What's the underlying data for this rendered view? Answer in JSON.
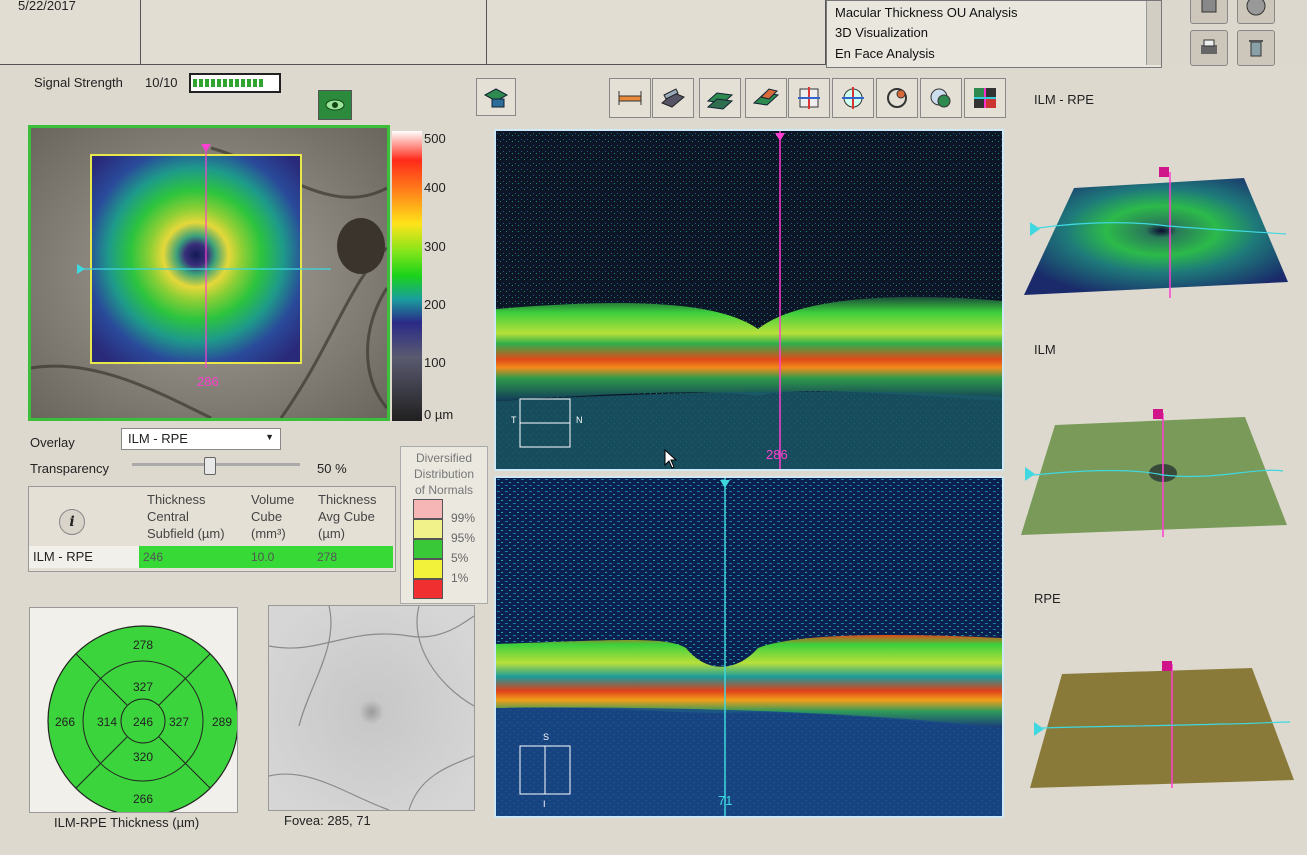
{
  "header": {
    "date": "5/22/2017",
    "menu": [
      "Macular Thickness OU Analysis",
      "3D Visualization",
      "En Face Analysis"
    ]
  },
  "signal": {
    "label": "Signal Strength",
    "value": "10/10",
    "level": 1.0
  },
  "scale": {
    "ticks": [
      "500",
      "400",
      "300",
      "200",
      "100",
      "0 µm"
    ]
  },
  "fundus": {
    "slice_label": "286"
  },
  "overlay": {
    "label": "Overlay",
    "selected": "ILM - RPE",
    "transparency_label": "Transparency",
    "transparency_value": "50 %",
    "transparency_fraction": 0.5
  },
  "table": {
    "headers": [
      [
        "Thickness",
        "Central",
        "Subfield (µm)"
      ],
      [
        "Volume",
        "Cube",
        "(mm³)"
      ],
      [
        "Thickness",
        "Avg Cube",
        "(µm)"
      ]
    ],
    "row_label": "ILM - RPE",
    "values": [
      "246",
      "10.0",
      "278"
    ]
  },
  "normals": {
    "title": [
      "Diversified",
      "Distribution",
      "of Normals"
    ],
    "levels": [
      "99%",
      "95%",
      "5%",
      "1%"
    ],
    "colors": [
      "#f6b6b6",
      "#f2f28a",
      "#38c838",
      "#f2f23a",
      "#f03030"
    ]
  },
  "etdrs": {
    "superior_outer": "278",
    "superior_inner": "327",
    "temporal_outer": "266",
    "temporal_inner": "314",
    "center": "246",
    "nasal_inner": "327",
    "nasal_outer": "289",
    "inferior_inner": "320",
    "inferior_outer": "266",
    "caption": "ILM-RPE Thickness (µm)"
  },
  "fovea": {
    "caption": "Fovea: 285, 71"
  },
  "bscan_top": {
    "slice_label": "286",
    "box_left": "T",
    "box_right": "N"
  },
  "bscan_bottom": {
    "slice_label": "71",
    "box_top": "S",
    "box_bottom": "I"
  },
  "surfaces": {
    "labels": [
      "ILM - RPE",
      "ILM",
      "RPE"
    ]
  },
  "colors": {
    "accent_green": "#36d936",
    "magenta": "#ff3fd0",
    "cyan": "#3fd8e0"
  }
}
